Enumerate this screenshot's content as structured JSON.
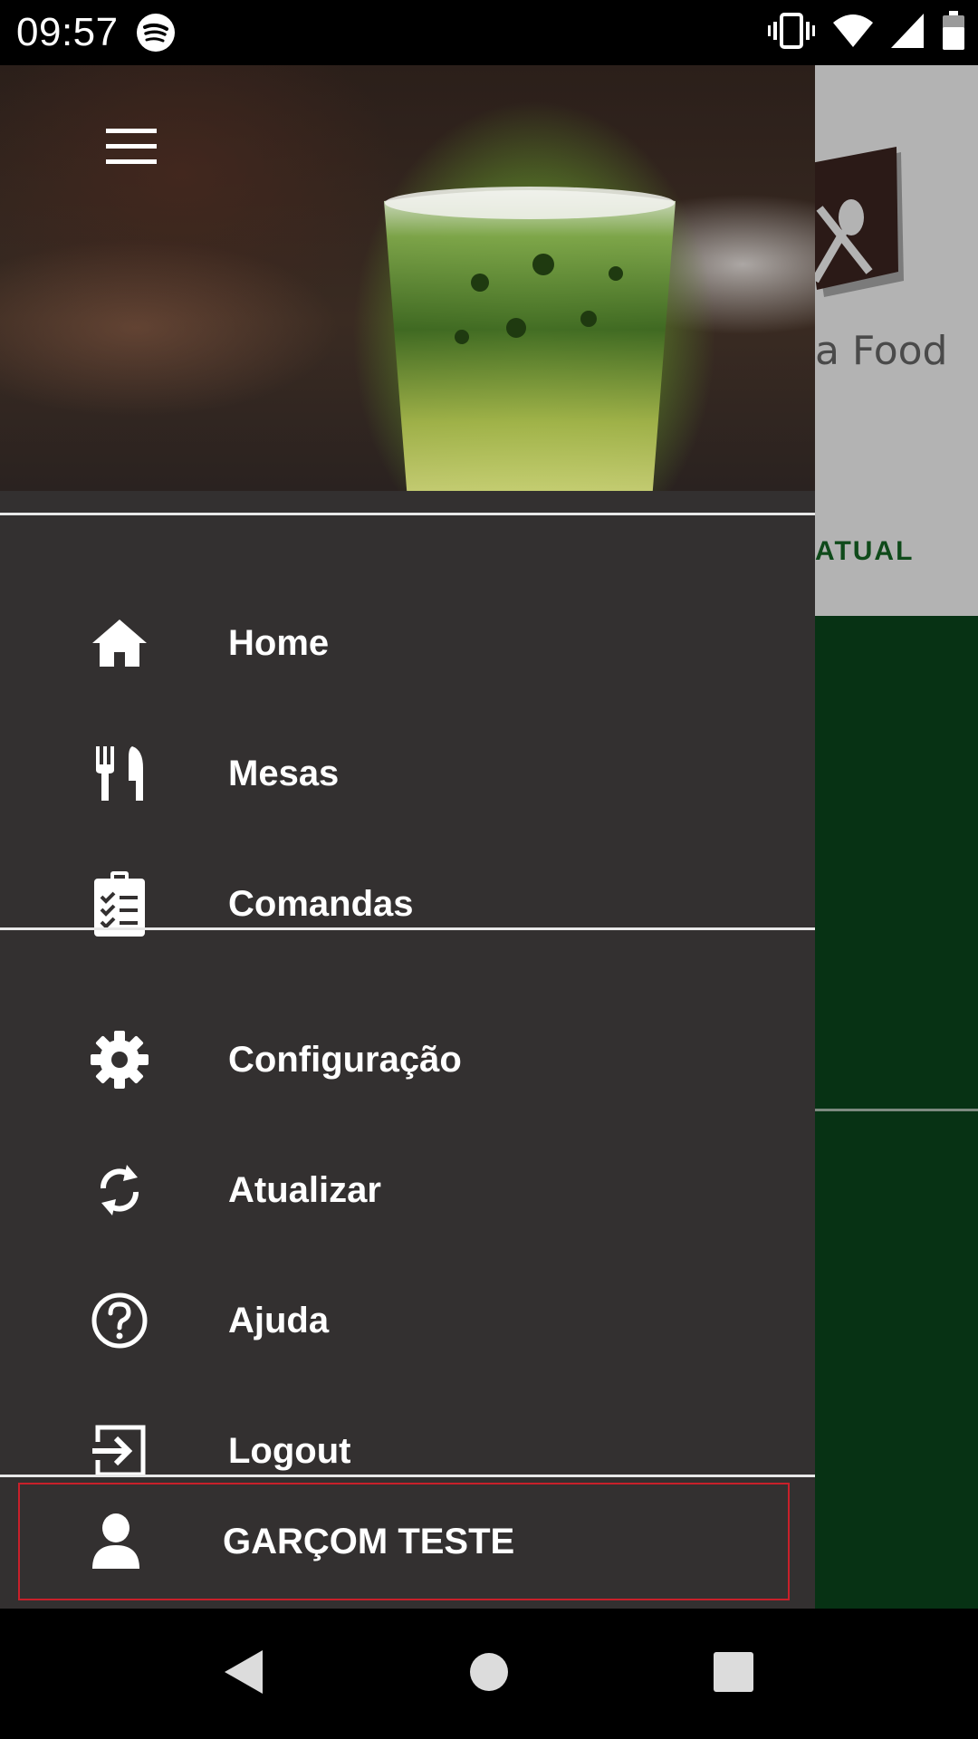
{
  "status_bar": {
    "time": "09:57",
    "icons": [
      "spotify-icon",
      "vibrate-icon",
      "wifi-icon",
      "signal-icon",
      "battery-icon"
    ]
  },
  "background_app": {
    "logo_text": "a Food",
    "brand_text": "ATUAL",
    "colors": {
      "top": "#b3b3b3",
      "bottom": "#073214"
    }
  },
  "drawer": {
    "menu_icon": "hamburger-menu-icon",
    "header_image": "green-drink-glass",
    "primary_items": [
      {
        "label": "Home",
        "icon": "home-icon"
      },
      {
        "label": "Mesas",
        "icon": "fork-knife-icon"
      },
      {
        "label": "Comandas",
        "icon": "clipboard-checklist-icon"
      }
    ],
    "secondary_items": [
      {
        "label": "Configuração",
        "icon": "gear-icon"
      },
      {
        "label": "Atualizar",
        "icon": "sync-icon"
      },
      {
        "label": "Ajuda",
        "icon": "help-circle-icon"
      },
      {
        "label": "Logout",
        "icon": "logout-icon"
      }
    ],
    "user": {
      "name": "GARÇOM TESTE",
      "icon": "person-icon"
    },
    "colors": {
      "background": "#333030",
      "text": "#ffffff",
      "user_border": "#c8202a"
    }
  },
  "nav_bar": {
    "buttons": [
      "back-icon",
      "home-circle-icon",
      "recents-square-icon"
    ]
  }
}
